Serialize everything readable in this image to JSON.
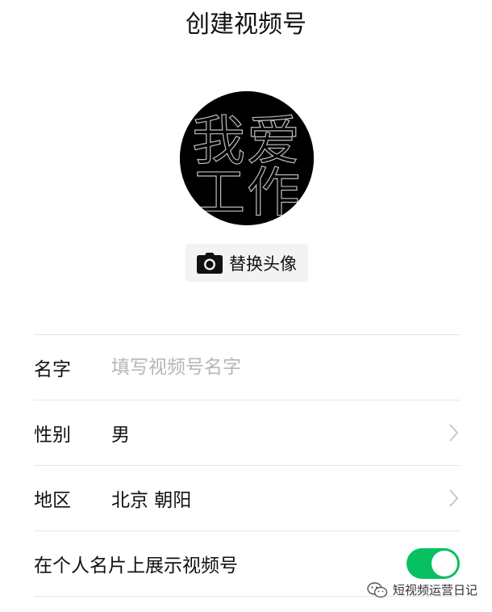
{
  "header": {
    "title": "创建视频号"
  },
  "avatar": {
    "text_line1": "我爱",
    "text_line2": "工作"
  },
  "change_avatar": {
    "icon": "camera-icon",
    "label": "替换头像"
  },
  "form": {
    "name": {
      "label": "名字",
      "placeholder": "填写视频号名字"
    },
    "gender": {
      "label": "性别",
      "value": "男",
      "icon": "chevron-right-icon"
    },
    "region": {
      "label": "地区",
      "value": "北京 朝阳",
      "icon": "chevron-right-icon"
    },
    "show_on_card": {
      "label": "在个人名片上展示视频号",
      "enabled": true
    }
  },
  "watermark": {
    "icon": "wechat-icon",
    "text": "短视频运营日记"
  },
  "colors": {
    "toggle_on": "#07c160",
    "divider": "#e5e5e5",
    "placeholder": "#b6b6b6"
  }
}
